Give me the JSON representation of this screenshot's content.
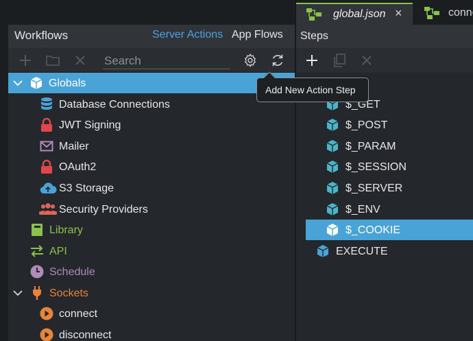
{
  "workflows_panel": {
    "title": "Workflows",
    "tabs": [
      "Server Actions",
      "App Flows"
    ],
    "toolbar": {
      "search_placeholder": "Search",
      "icons": [
        "add-icon",
        "folder-icon",
        "delete-icon",
        "gear-icon",
        "refresh-icon"
      ]
    },
    "tree": [
      {
        "label": "Globals",
        "icon": "cube-icon",
        "selected": true,
        "expanded": true,
        "color": "#ffffff"
      },
      {
        "label": "Database Connections",
        "icon": "database-icon",
        "color": "#e8e8e8",
        "icon_color": "#4aa3d6"
      },
      {
        "label": "JWT Signing",
        "icon": "lock-icon",
        "color": "#e8e8e8",
        "icon_color": "#e0464b"
      },
      {
        "label": "Mailer",
        "icon": "mail-icon",
        "color": "#e8e8e8",
        "icon_color": "#b08ab8"
      },
      {
        "label": "OAuth2",
        "icon": "lock-icon",
        "color": "#e8e8e8",
        "icon_color": "#e0464b"
      },
      {
        "label": "S3 Storage",
        "icon": "cloud-upload-icon",
        "color": "#e8e8e8",
        "icon_color": "#4aa3d6"
      },
      {
        "label": "Security Providers",
        "icon": "users-icon",
        "color": "#e8e8e8",
        "icon_color": "#e0665a"
      },
      {
        "label": "Library",
        "icon": "book-icon",
        "color": "#8bc24a",
        "icon_color": "#8bc24a"
      },
      {
        "label": "API",
        "icon": "swap-icon",
        "color": "#8bc24a",
        "icon_color": "#8bc24a"
      },
      {
        "label": "Schedule",
        "icon": "clock-icon",
        "color": "#b08ab8",
        "icon_color": "#b08ab8"
      },
      {
        "label": "Sockets",
        "icon": "plug-icon",
        "color": "#e8843a",
        "icon_color": "#e8843a",
        "expanded": true
      },
      {
        "label": "connect",
        "icon": "play-icon",
        "color": "#e8e8e8",
        "icon_color": "#e8843a"
      },
      {
        "label": "disconnect",
        "icon": "play-icon",
        "color": "#e8e8e8",
        "icon_color": "#e8843a"
      }
    ]
  },
  "editor_tabs": [
    {
      "label": "global.json",
      "icon": "flow-icon",
      "active": true,
      "close": "×"
    },
    {
      "label": "connect",
      "icon": "flow-icon",
      "active": false
    }
  ],
  "steps_panel": {
    "title": "Steps",
    "toolbar": {
      "icons": [
        "add-step-icon",
        "copy-icon",
        "delete-icon"
      ]
    },
    "steps": [
      {
        "label": "$_GET",
        "icon": "cube-icon"
      },
      {
        "label": "$_POST",
        "icon": "cube-icon"
      },
      {
        "label": "$_PARAM",
        "icon": "cube-icon"
      },
      {
        "label": "$_SESSION",
        "icon": "cube-icon"
      },
      {
        "label": "$_SERVER",
        "icon": "cube-icon"
      },
      {
        "label": "$_ENV",
        "icon": "cube-icon"
      },
      {
        "label": "$_COOKIE",
        "icon": "cube-icon",
        "selected": true
      },
      {
        "label": "EXECUTE",
        "icon": "cube-icon"
      }
    ]
  },
  "tooltip": {
    "text": "Add New Action Step"
  },
  "colors": {
    "accent": "#4aa3d6",
    "link": "#4aa3e0",
    "tab_active_border": "#8bc24a"
  }
}
